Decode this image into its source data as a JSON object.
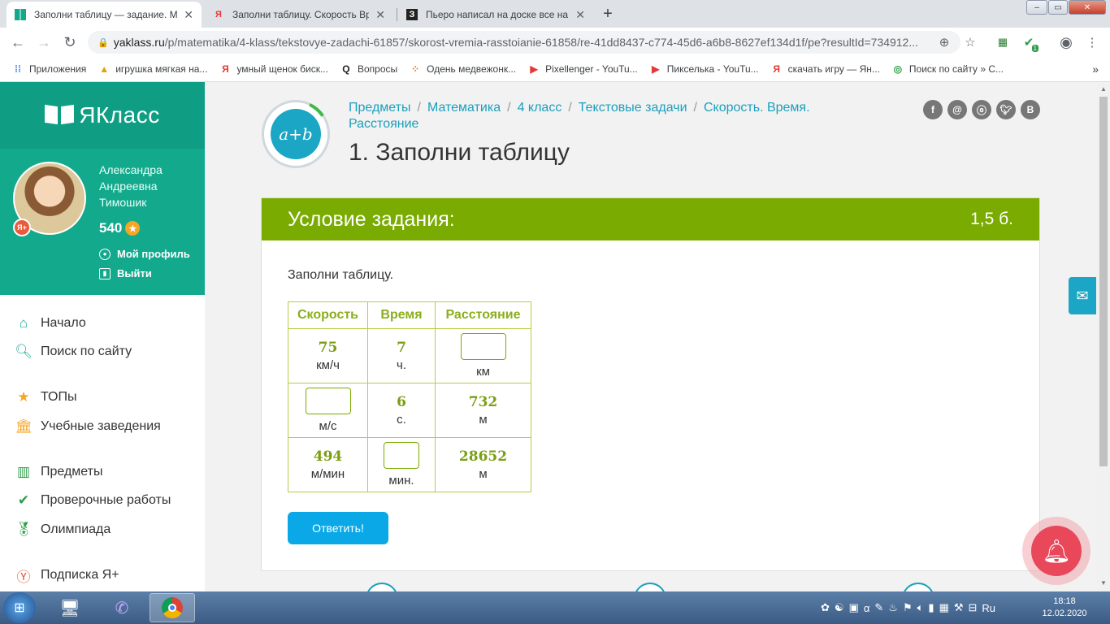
{
  "browser": {
    "tabs": [
      {
        "title": "Заполни таблицу — задание. М",
        "favicon": "yaklass",
        "active": true
      },
      {
        "title": "Заполни таблицу. Скорость Вре",
        "favicon": "Я",
        "active": false
      },
      {
        "title": "Пьеро написал на доске все на",
        "favicon": "З",
        "active": false
      }
    ],
    "url_host": "yaklass.ru",
    "url_path": "/p/matematika/4-klass/tekstovye-zadachi-61857/skorost-vremia-rasstoianie-61858/re-41dd8437-c774-45d6-a6b8-8627ef134d1f/pe?resultId=734912...",
    "extension_badge": "1",
    "bookmarks": [
      {
        "label": "Приложения",
        "icon": "apps-grid"
      },
      {
        "label": "игрушка мягкая на...",
        "icon": "image"
      },
      {
        "label": "умный щенок биск...",
        "icon": "Я"
      },
      {
        "label": "Вопросы",
        "icon": "Q"
      },
      {
        "label": "Одень медвежонк...",
        "icon": "dots"
      },
      {
        "label": "Pixellenger - YouTu...",
        "icon": "youtube"
      },
      {
        "label": "Пикселька - YouTu...",
        "icon": "youtube"
      },
      {
        "label": "скачать игру — Ян...",
        "icon": "Я"
      },
      {
        "label": "Поиск по сайту » С...",
        "icon": "ucoz"
      }
    ]
  },
  "sidebar": {
    "logo": "ЯКласс",
    "user": {
      "name": "Александра Андреевна Тимошик",
      "points": "540",
      "profile_link": "Мой профиль",
      "logout_link": "Выйти"
    },
    "nav": [
      {
        "label": "Начало",
        "icon": "home-icon"
      },
      {
        "label": "Поиск по сайту",
        "icon": "search-icon"
      },
      {
        "label": "ТОПы",
        "icon": "star-icon"
      },
      {
        "label": "Учебные заведения",
        "icon": "school-icon"
      },
      {
        "label": "Предметы",
        "icon": "books-icon"
      },
      {
        "label": "Проверочные работы",
        "icon": "check-icon"
      },
      {
        "label": "Олимпиада",
        "icon": "medal-icon"
      },
      {
        "label": "Подписка Я+",
        "icon": "yaplus-icon"
      }
    ]
  },
  "main": {
    "subject_badge": "a+b",
    "breadcrumbs": [
      "Предметы",
      "Математика",
      "4 класс",
      "Текстовые задачи",
      "Скорость. Время. Расстояние"
    ],
    "title": "1. Заполни таблицу",
    "social": [
      "f",
      "@",
      "ok",
      "tw",
      "В"
    ],
    "card": {
      "header": "Условие задания:",
      "points": "1,5 б.",
      "instruction": "Заполни таблицу.",
      "table": {
        "headers": [
          "Скорость",
          "Время",
          "Расстояние"
        ],
        "rows": [
          [
            {
              "value": "75",
              "unit": "км/ч"
            },
            {
              "value": "7",
              "unit": "ч."
            },
            {
              "value": "",
              "unit": "км",
              "input": true
            }
          ],
          [
            {
              "value": "",
              "unit": "м/с",
              "input": true
            },
            {
              "value": "6",
              "unit": "с."
            },
            {
              "value": "732",
              "unit": "м"
            }
          ],
          [
            {
              "value": "494",
              "unit": "м/мин"
            },
            {
              "value": "",
              "unit": "мин.",
              "input": true
            },
            {
              "value": "28652",
              "unit": "м"
            }
          ]
        ]
      },
      "submit": "Ответить!"
    }
  },
  "taskbar": {
    "language": "Ru",
    "time": "18:18",
    "date": "12.02.2020"
  },
  "colors": {
    "brand_green": "#13a98d",
    "header_green": "#7aab00",
    "link_blue": "#1a9fbd",
    "button_blue": "#0aa8e6"
  }
}
